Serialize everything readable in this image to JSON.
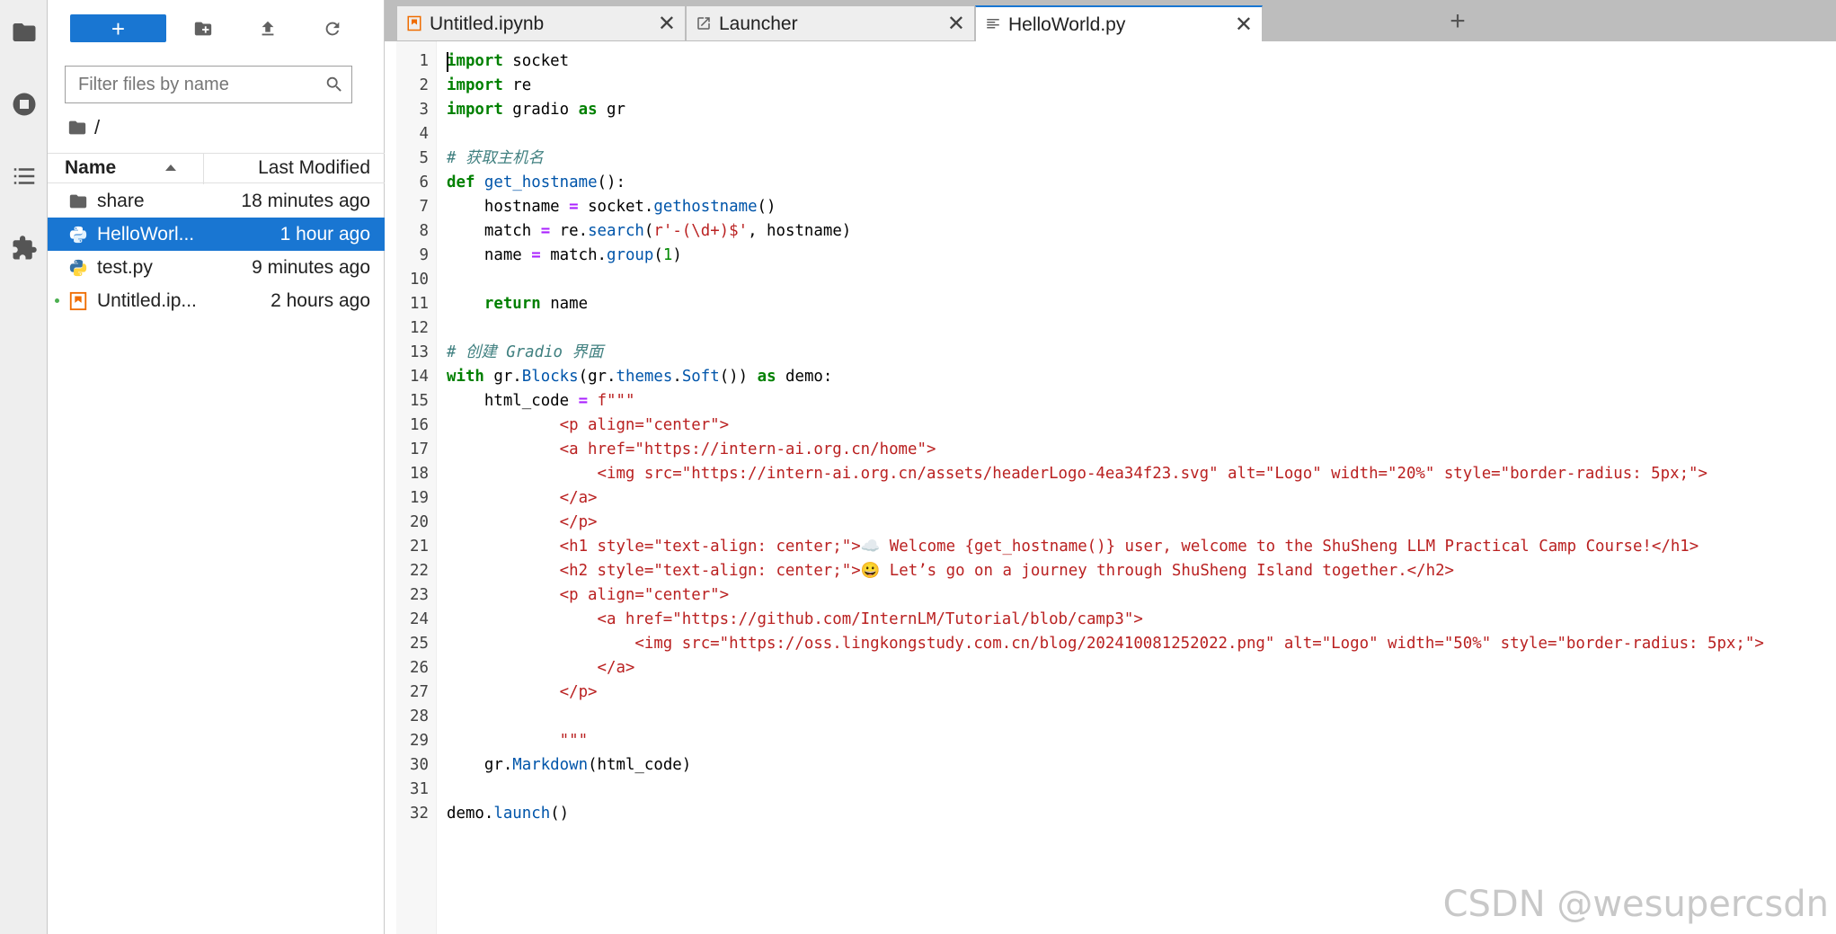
{
  "file_browser": {
    "new_label": "+",
    "filter_placeholder": "Filter files by name",
    "breadcrumb": "/",
    "columns": {
      "name": "Name",
      "modified": "Last Modified"
    },
    "files": [
      {
        "name": "share",
        "modified": "18 minutes ago",
        "icon": "folder-icon"
      },
      {
        "name": "HelloWorl...",
        "modified": "1 hour ago",
        "icon": "python-icon"
      },
      {
        "name": "test.py",
        "modified": "9 minutes ago",
        "icon": "python-icon"
      },
      {
        "name": "Untitled.ip...",
        "modified": "2 hours ago",
        "icon": "notebook-icon"
      }
    ]
  },
  "tabs": [
    {
      "label": "Untitled.ipynb",
      "close": "✕"
    },
    {
      "label": "Launcher",
      "close": "✕"
    },
    {
      "label": "HelloWorld.py",
      "close": "✕"
    }
  ],
  "add_tab": "+",
  "editor": {
    "line_numbers": [
      "1",
      "2",
      "3",
      "4",
      "5",
      "6",
      "7",
      "8",
      "9",
      "10",
      "11",
      "12",
      "13",
      "14",
      "15",
      "16",
      "17",
      "18",
      "19",
      "20",
      "21",
      "22",
      "23",
      "24",
      "25",
      "26",
      "27",
      "28",
      "29",
      "30",
      "31",
      "32"
    ],
    "lines": [
      "import socket",
      "import re",
      "import gradio as gr",
      "",
      "# 获取主机名",
      "def get_hostname():",
      "    hostname = socket.gethostname()",
      "    match = re.search(r'-(\\d+)$', hostname)",
      "    name = match.group(1)",
      "",
      "    return name",
      "",
      "# 创建 Gradio 界面",
      "with gr.Blocks(gr.themes.Soft()) as demo:",
      "    html_code = f\"\"\"",
      "            <p align=\"center\">",
      "            <a href=\"https://intern-ai.org.cn/home\">",
      "                <img src=\"https://intern-ai.org.cn/assets/headerLogo-4ea34f23.svg\" alt=\"Logo\" width=\"20%\" style=\"border-radius: 5px;\">",
      "            </a>",
      "            </p>",
      "            <h1 style=\"text-align: center;\">☁️ Welcome {get_hostname()} user, welcome to the ShuSheng LLM Practical Camp Course!</h1>",
      "            <h2 style=\"text-align: center;\">😀 Let’s go on a journey through ShuSheng Island together.</h2>",
      "            <p align=\"center\">",
      "                <a href=\"https://github.com/InternLM/Tutorial/blob/camp3\">",
      "                    <img src=\"https://oss.lingkongstudy.com.cn/blog/202410081252022.png\" alt=\"Logo\" width=\"50%\" style=\"border-radius: 5px;\">",
      "                </a>",
      "            </p>",
      "",
      "            \"\"\"",
      "    gr.Markdown(html_code)",
      "",
      "demo.launch()"
    ]
  },
  "watermark": "CSDN @wesupercsdn"
}
